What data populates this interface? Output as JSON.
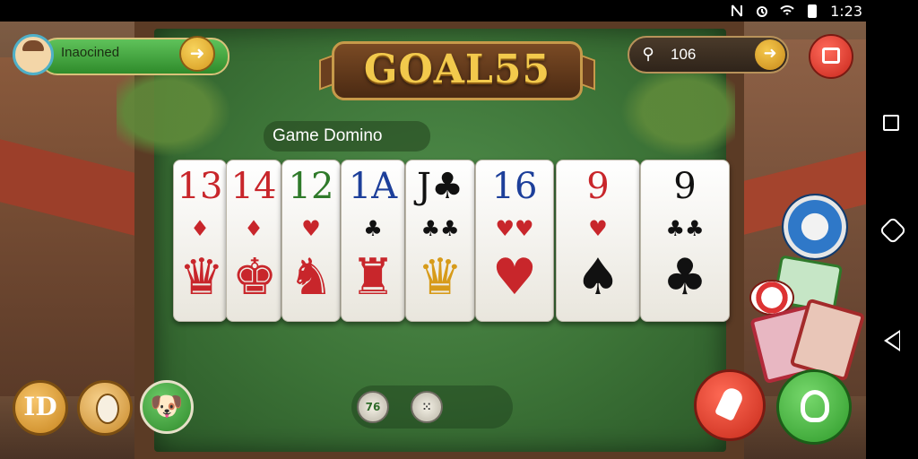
{
  "status_bar": {
    "time": "1:23",
    "icons": [
      "nfc-icon",
      "alarm-icon",
      "wifi-icon",
      "battery-icon"
    ]
  },
  "profile": {
    "name": "Inaocined",
    "action_icon": "arrow-right-icon"
  },
  "title": "GOAL55",
  "search": {
    "value": "106",
    "icon": "key-icon",
    "go_icon": "arrow-right-icon"
  },
  "top_right_button": {
    "icon": "store-icon"
  },
  "section_label": "Game Domino",
  "cards": [
    {
      "rank": "13",
      "pip": "♦",
      "suit_color": "red",
      "art": "♛"
    },
    {
      "rank": "14",
      "pip": "♦",
      "suit_color": "red",
      "art": "♚"
    },
    {
      "rank": "12",
      "pip": "♥",
      "suit_color": "green",
      "art": "♞"
    },
    {
      "rank": "1A",
      "pip": "♣",
      "suit_color": "blue",
      "art": "♜"
    },
    {
      "rank": "J♣",
      "pip": "♣♣",
      "suit_color": "black",
      "art": "♛"
    },
    {
      "rank": "16",
      "pip": "♥♥",
      "suit_color": "red",
      "art": "♥"
    },
    {
      "rank": "9",
      "pip": "♥",
      "suit_color": "red",
      "art": "♠"
    },
    {
      "rank": "9",
      "pip": "♣♣",
      "suit_color": "black",
      "art": "♣"
    }
  ],
  "bottom_left_buttons": [
    {
      "label": "ID",
      "icon": "id-icon"
    },
    {
      "label": "",
      "icon": "mask-icon"
    },
    {
      "label": "",
      "icon": "pet-icon"
    }
  ],
  "bottom_center_tokens": [
    {
      "label": "76",
      "icon": "token-icon"
    },
    {
      "label": "",
      "icon": "dots-icon"
    }
  ],
  "bottom_right_buttons": [
    {
      "icon": "hand-icon",
      "color": "#d8352a"
    },
    {
      "icon": "turtle-icon",
      "color": "#3aa63a"
    }
  ],
  "android_nav": [
    "recent-apps-icon",
    "home-icon",
    "back-icon"
  ]
}
